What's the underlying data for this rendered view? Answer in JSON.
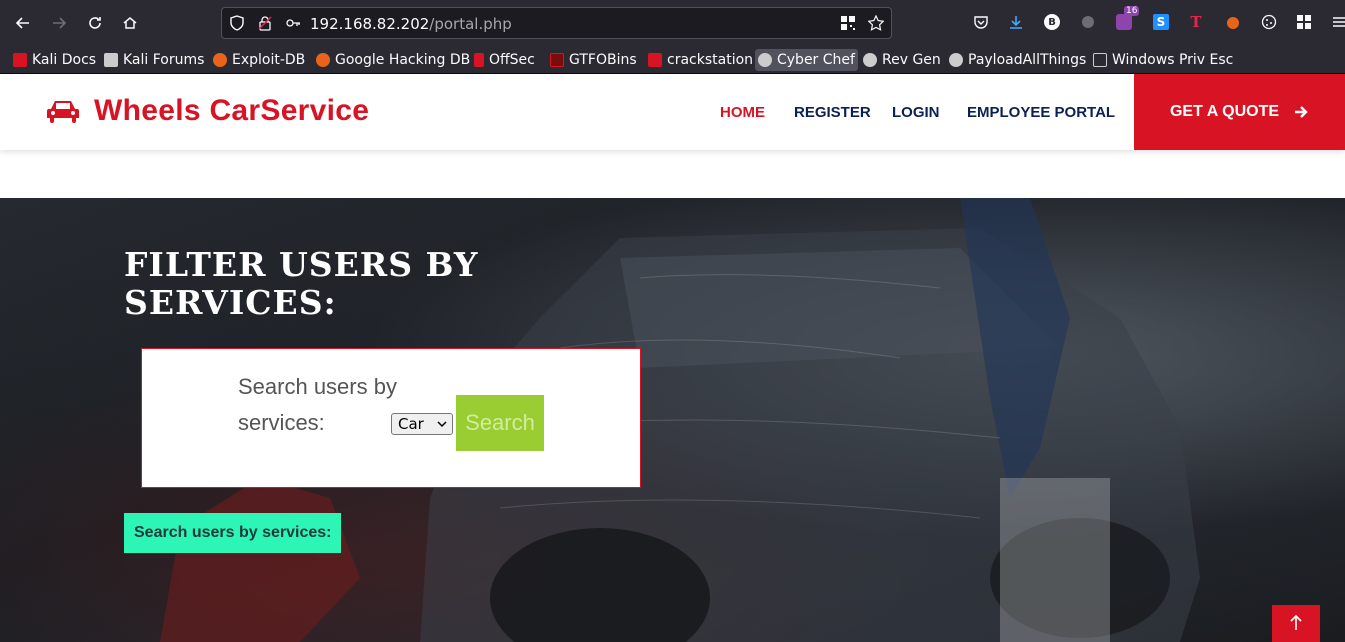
{
  "browser": {
    "url_host": "192.168.82.202",
    "url_path": "/portal.php",
    "extension_badge": "16",
    "bookmarks": [
      {
        "label": "Kali Docs",
        "color": "#d81324"
      },
      {
        "label": "Kali Forums",
        "color": "#cccccc"
      },
      {
        "label": "Exploit-DB",
        "color": "#e8641b"
      },
      {
        "label": "Google Hacking DB",
        "color": "#e8641b"
      },
      {
        "label": "OffSec",
        "color": "#d81324"
      },
      {
        "label": "GTFOBins",
        "color": "#d81324"
      },
      {
        "label": "crackstation",
        "color": "#d81324"
      },
      {
        "label": "Cyber Chef",
        "color": "#cccccc"
      },
      {
        "label": "Rev Gen",
        "color": "#cccccc"
      },
      {
        "label": "PayloadAllThings",
        "color": "#cccccc"
      },
      {
        "label": "Windows Priv Esc",
        "color": "#cccccc"
      }
    ]
  },
  "site": {
    "brand": "Wheels CarService",
    "menu": [
      "HOME",
      "REGISTER",
      "LOGIN",
      "EMPLOYEE PORTAL"
    ],
    "active_menu": "HOME",
    "quote_button": "GET A QUOTE",
    "accent_color": "#d81324"
  },
  "hero": {
    "title": "FILTER USERS BY SERVICES:",
    "filter_label": "Search users by services:",
    "select_value": "Car",
    "search_button": "Search",
    "result_label": "Search users by services:"
  }
}
